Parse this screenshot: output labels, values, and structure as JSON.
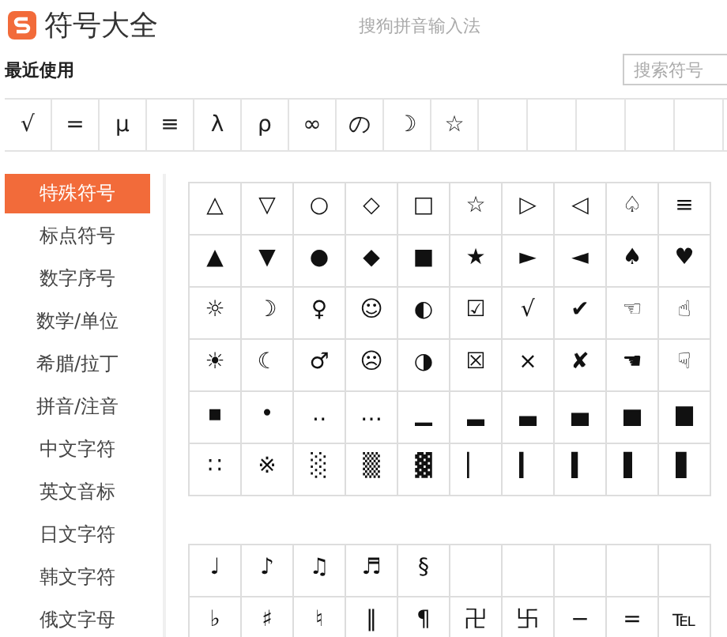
{
  "header": {
    "title": "符号大全",
    "subtitle": "搜狗拼音输入法"
  },
  "recent": {
    "label": "最近使用",
    "search": {
      "placeholder": "搜索符号"
    },
    "symbols": [
      "√",
      "=",
      "μ",
      "≡",
      "λ",
      "ρ",
      "∞",
      "の",
      "☽",
      "☆"
    ]
  },
  "sidebar": {
    "items": [
      {
        "label": "特殊符号",
        "selected": true
      },
      {
        "label": "标点符号",
        "selected": false
      },
      {
        "label": "数字序号",
        "selected": false
      },
      {
        "label": "数学/单位",
        "selected": false
      },
      {
        "label": "希腊/拉丁",
        "selected": false
      },
      {
        "label": "拼音/注音",
        "selected": false
      },
      {
        "label": "中文字符",
        "selected": false
      },
      {
        "label": "英文音标",
        "selected": false
      },
      {
        "label": "日文字符",
        "selected": false
      },
      {
        "label": "韩文字符",
        "selected": false
      },
      {
        "label": "俄文字母",
        "selected": false
      }
    ]
  },
  "symbol_tables": [
    {
      "rows": [
        [
          "△",
          "▽",
          "○",
          "◇",
          "□",
          "☆",
          "▷",
          "◁",
          "♤",
          "≡"
        ],
        [
          "▲",
          "▼",
          "●",
          "◆",
          "■",
          "★",
          "►",
          "◄",
          "♠",
          "♥"
        ],
        [
          "☼",
          "☽",
          "♀",
          "☺",
          "◐",
          "☑",
          "√",
          "✔",
          "☜",
          "☝"
        ],
        [
          "☀",
          "☾",
          "♂",
          "☹",
          "◑",
          "☒",
          "×",
          "✘",
          "☚",
          "☟"
        ],
        [
          "▪",
          "•",
          "‥",
          "…",
          "▁",
          "▂",
          "▃",
          "▄",
          "▅",
          "▆"
        ],
        [
          "∷",
          "※",
          "░",
          "▒",
          "▓",
          "▏",
          "▎",
          "▍",
          "▌",
          "▋"
        ]
      ]
    },
    {
      "rows": [
        [
          "♩",
          "♪",
          "♫",
          "♬",
          "§"
        ],
        [
          "♭",
          "♯",
          "♮",
          "‖",
          "¶",
          "卍",
          "卐",
          "−",
          "=",
          "℡"
        ]
      ]
    }
  ]
}
